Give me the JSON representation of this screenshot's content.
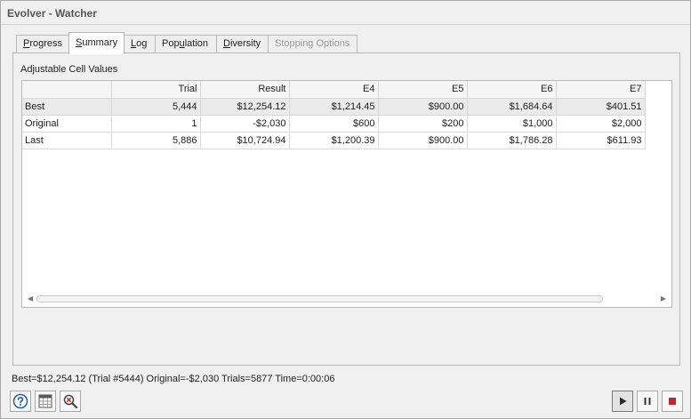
{
  "window": {
    "title": "Evolver - Watcher"
  },
  "tabs": [
    {
      "pre": "",
      "u": "P",
      "post": "rogress"
    },
    {
      "pre": "",
      "u": "S",
      "post": "ummary"
    },
    {
      "pre": "",
      "u": "L",
      "post": "og"
    },
    {
      "pre": "Pop",
      "u": "u",
      "post": "lation"
    },
    {
      "pre": "",
      "u": "D",
      "post": "iversity"
    },
    {
      "pre": "Stopping Options",
      "u": "",
      "post": ""
    }
  ],
  "summary": {
    "group_label": "Adjustable Cell Values",
    "columns": [
      "",
      "Trial",
      "Result",
      "E4",
      "E5",
      "E6",
      "E7"
    ],
    "rows": [
      [
        "Best",
        "5,444",
        "$12,254.12",
        "$1,214.45",
        "$900.00",
        "$1,684.64",
        "$401.51"
      ],
      [
        "Original",
        "1",
        "-$2,030",
        "$600",
        "$200",
        "$1,000",
        "$2,000"
      ],
      [
        "Last",
        "5,886",
        "$10,724.94",
        "$1,200.39",
        "$900.00",
        "$1,786.28",
        "$611.93"
      ]
    ]
  },
  "status": "Best=$12,254.12 (Trial #5444) Original=-$2,030 Trials=5877 Time=0:00:06",
  "icons": {
    "help": "help-icon",
    "spreadsheet": "spreadsheet-icon",
    "zoom": "zoom-icon",
    "play": "play-icon",
    "pause": "pause-icon",
    "stop": "stop-icon"
  },
  "colors": {
    "stop": "#c0272d",
    "help": "#1f5fa8",
    "play": "#2b2b2b"
  }
}
